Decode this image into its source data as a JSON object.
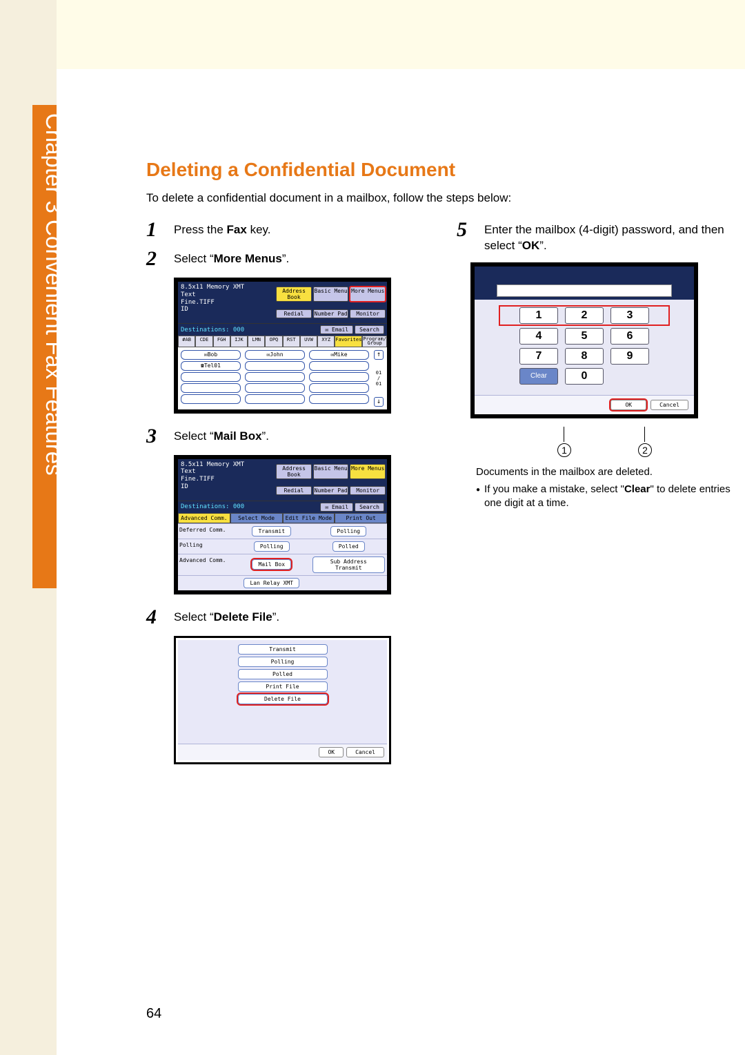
{
  "sidebar": {
    "label": "Chapter 3    Convenient Fax Features"
  },
  "title": "Deleting a Confidential Document",
  "intro": "To delete a confidential document in a mailbox, follow the steps below:",
  "steps": {
    "s1": {
      "n": "1",
      "pre": "Press the ",
      "bold": "Fax",
      "post": " key."
    },
    "s2": {
      "n": "2",
      "pre": "Select “",
      "bold": "More Menus",
      "post": "”."
    },
    "s3": {
      "n": "3",
      "pre": "Select “",
      "bold": "Mail Box",
      "post": "”."
    },
    "s4": {
      "n": "4",
      "pre": "Select “",
      "bold": "Delete File",
      "post": "”."
    },
    "s5": {
      "n": "5",
      "pre": "Enter the mailbox (4-digit) password, and then select “",
      "bold": "OK",
      "post": "”."
    }
  },
  "scr2": {
    "header1": "8.5x11   Memory XMT",
    "header2": "         Text",
    "header3": "         Fine.TIFF",
    "header4": "                 ID",
    "addr": "Address Book",
    "basic": "Basic Menu",
    "more": "More Menus",
    "redial": "Redial",
    "numpad": "Number Pad",
    "monitor": "Monitor",
    "dest": "Destinations: 000",
    "email": "Email",
    "search": "Search",
    "alpha": [
      "#AB",
      "CDE",
      "FGH",
      "IJK",
      "LMN",
      "OPQ",
      "RST",
      "UVW",
      "XYZ",
      "Favorites",
      "Program/\nGroup"
    ],
    "names": [
      "Bob",
      "John",
      "Mike",
      "Tel01"
    ],
    "page": "01\n/\n01"
  },
  "scr3": {
    "tabs": [
      "Advanced Comm.",
      "Select Mode",
      "Edit File Mode",
      "Print Out"
    ],
    "rows": [
      {
        "label": "Deferred Comm.",
        "btns": [
          "Transmit",
          "Polling"
        ]
      },
      {
        "label": "Polling",
        "btns": [
          "Polling",
          "Polled"
        ]
      },
      {
        "label": "Advanced Comm.",
        "btns": [
          "Mail Box",
          "Sub Address Transmit"
        ],
        "hl": 0
      },
      {
        "label": "",
        "btns": [
          "Lan Relay XMT"
        ]
      }
    ]
  },
  "scr4": {
    "buttons": [
      "Transmit",
      "Polling",
      "Polled",
      "Print File",
      "Delete File"
    ],
    "hl": 4,
    "ok": "OK",
    "cancel": "Cancel"
  },
  "scr5": {
    "keys": [
      [
        "1",
        "2",
        "3"
      ],
      [
        "4",
        "5",
        "6"
      ],
      [
        "7",
        "8",
        "9"
      ],
      [
        "Clear",
        "0",
        ""
      ]
    ],
    "ok": "OK",
    "cancel": "Cancel",
    "callout1": "1",
    "callout2": "2"
  },
  "note1": "Documents in the mailbox are deleted.",
  "note2a": "If you make a mistake, select \"",
  "note2b": "Clear",
  "note2c": "\" to delete entries one digit at a time.",
  "page_num": "64"
}
